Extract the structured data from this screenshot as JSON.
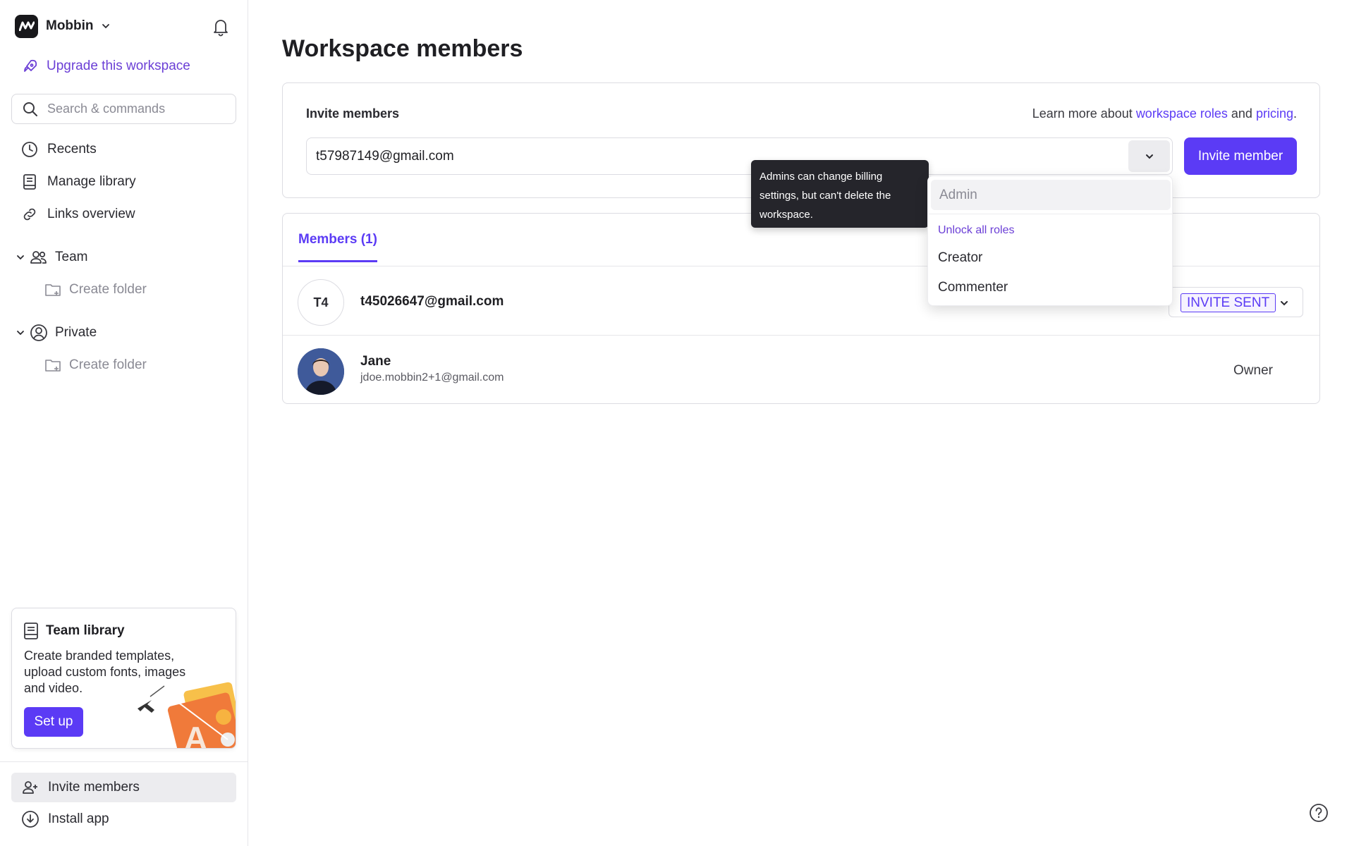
{
  "sidebar": {
    "workspace_name": "Mobbin",
    "upgrade_label": "Upgrade this workspace",
    "search_placeholder": "Search & commands",
    "nav": {
      "recents": "Recents",
      "manage_library": "Manage library",
      "links_overview": "Links overview"
    },
    "groups": {
      "team": {
        "label": "Team",
        "create_folder": "Create folder"
      },
      "private": {
        "label": "Private",
        "create_folder": "Create folder"
      }
    },
    "promo": {
      "title": "Team library",
      "text": "Create branded templates, upload custom fonts, images and video.",
      "button": "Set up"
    },
    "bottom": {
      "invite_members": "Invite members",
      "install_app": "Install app"
    }
  },
  "main": {
    "title": "Workspace members",
    "invite": {
      "label": "Invite members",
      "learn_prefix": "Learn more about",
      "learn_link_roles": "workspace roles",
      "learn_and": "and",
      "learn_link_pricing": "pricing",
      "learn_suffix": ".",
      "email_value": "t57987149@gmail.com",
      "button": "Invite member"
    },
    "members": {
      "tab_label": "Members (1)",
      "rows": [
        {
          "initials": "T4",
          "email": "t45026647@gmail.com",
          "status": "INVITE SENT"
        },
        {
          "name": "Jane",
          "email": "jdoe.mobbin2+1@gmail.com",
          "role": "Owner"
        }
      ]
    }
  },
  "role_dropdown": {
    "selected": "Admin",
    "unlock_label": "Unlock all roles",
    "options": [
      "Creator",
      "Commenter"
    ]
  },
  "tooltip": {
    "text": "Admins can change billing settings, but can't delete the workspace."
  },
  "colors": {
    "accent": "#5b3bf5",
    "link": "#6b3fd6",
    "tooltip_bg": "#25252b"
  }
}
